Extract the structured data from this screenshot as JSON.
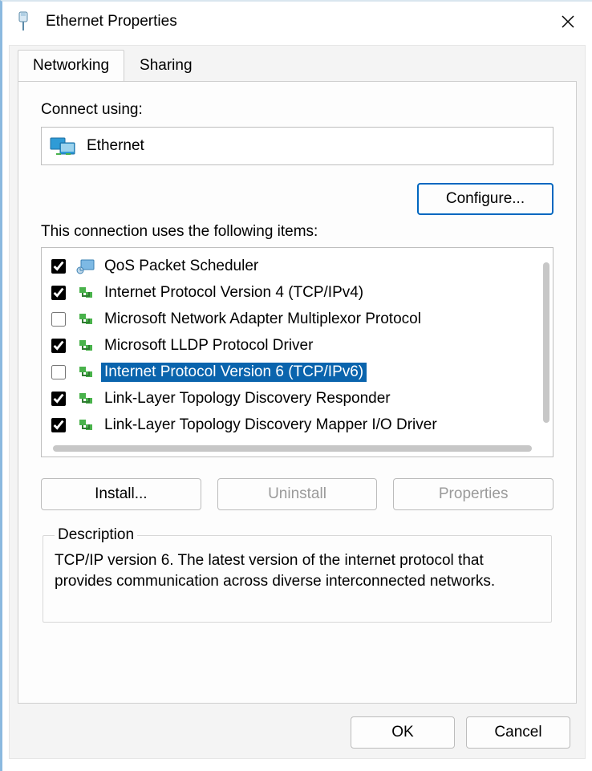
{
  "title": "Ethernet Properties",
  "tabs": {
    "networking": "Networking",
    "sharing": "Sharing"
  },
  "connect_label": "Connect using:",
  "adapter_name": "Ethernet",
  "configure_label": "Configure...",
  "items_label": "This connection uses the following items:",
  "items": [
    {
      "label": "QoS Packet Scheduler",
      "checked": true,
      "icon": "qos",
      "selected": false
    },
    {
      "label": "Internet Protocol Version 4 (TCP/IPv4)",
      "checked": true,
      "icon": "protocol",
      "selected": false
    },
    {
      "label": "Microsoft Network Adapter Multiplexor Protocol",
      "checked": false,
      "icon": "protocol",
      "selected": false
    },
    {
      "label": "Microsoft LLDP Protocol Driver",
      "checked": true,
      "icon": "protocol",
      "selected": false
    },
    {
      "label": "Internet Protocol Version 6 (TCP/IPv6)",
      "checked": false,
      "icon": "protocol",
      "selected": true
    },
    {
      "label": "Link-Layer Topology Discovery Responder",
      "checked": true,
      "icon": "protocol",
      "selected": false
    },
    {
      "label": "Link-Layer Topology Discovery Mapper I/O Driver",
      "checked": true,
      "icon": "protocol",
      "selected": false
    }
  ],
  "buttons": {
    "install": "Install...",
    "uninstall": "Uninstall",
    "properties": "Properties",
    "ok": "OK",
    "cancel": "Cancel"
  },
  "description_heading": "Description",
  "description_text": "TCP/IP version 6. The latest version of the internet protocol that provides communication across diverse interconnected networks."
}
